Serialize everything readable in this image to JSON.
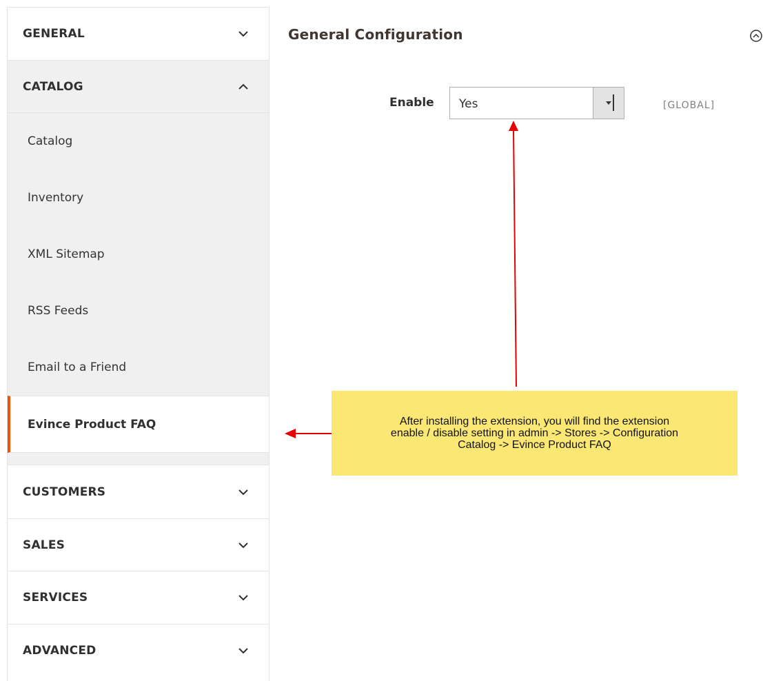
{
  "sidebar": {
    "general": {
      "label": "GENERAL",
      "state": "collapsed"
    },
    "catalog": {
      "label": "CATALOG",
      "state": "expanded",
      "items": [
        {
          "label": "Catalog"
        },
        {
          "label": "Inventory"
        },
        {
          "label": "XML Sitemap"
        },
        {
          "label": "RSS Feeds"
        },
        {
          "label": "Email to a Friend"
        },
        {
          "label": "Evince Product FAQ",
          "active": true
        }
      ]
    },
    "customers": {
      "label": "CUSTOMERS",
      "state": "collapsed"
    },
    "sales": {
      "label": "SALES",
      "state": "collapsed"
    },
    "services": {
      "label": "SERVICES",
      "state": "collapsed"
    },
    "advanced": {
      "label": "ADVANCED",
      "state": "collapsed"
    }
  },
  "main": {
    "section_title": "General Configuration",
    "enable_field": {
      "label": "Enable",
      "value": "Yes",
      "scope": "[GLOBAL]"
    }
  },
  "annotation": {
    "line1": "After installing the extension, you will find the extension",
    "line2": "enable / disable setting in admin -> Stores -> Configuration",
    "line3": "Catalog -> Evince Product FAQ"
  },
  "colors": {
    "accent": "#eb5202",
    "note_bg": "#fbe774",
    "arrow": "#e60000",
    "catalog_bg": "#f0f0f0"
  }
}
